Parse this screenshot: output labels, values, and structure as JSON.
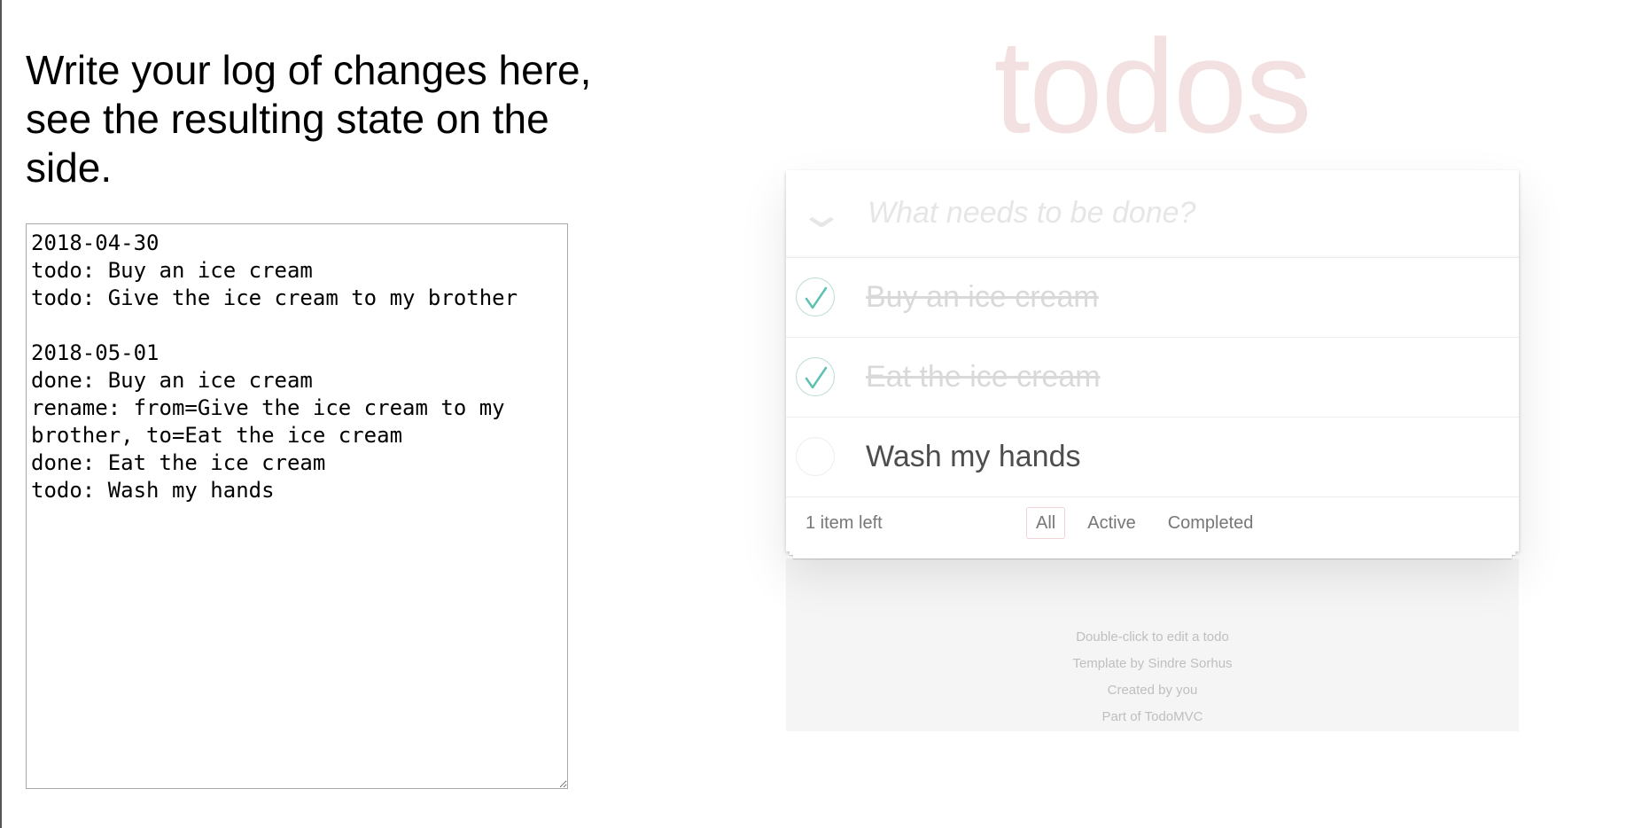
{
  "intro": {
    "text": "Write your log of changes here, see the resulting state on the side."
  },
  "log": {
    "value": "2018-04-30\ntodo: Buy an ice cream\ntodo: Give the ice cream to my brother\n\n2018-05-01\ndone: Buy an ice cream\nrename: from=Give the ice cream to my brother, to=Eat the ice cream\ndone: Eat the ice cream\ntodo: Wash my hands"
  },
  "todoapp": {
    "title": "todos",
    "new_todo_placeholder": "What needs to be done?",
    "toggle_all_icon": "chevron-down-icon",
    "items": [
      {
        "label": "Buy an ice cream",
        "completed": true
      },
      {
        "label": "Eat the ice cream",
        "completed": true
      },
      {
        "label": "Wash my hands",
        "completed": false
      }
    ],
    "footer": {
      "count": "1 item left",
      "filters": [
        "All",
        "Active",
        "Completed"
      ],
      "selected_filter": "All"
    },
    "colors": {
      "check": "#5dc2af",
      "title": "#af2f2f"
    }
  },
  "info": {
    "line1": "Double-click to edit a todo",
    "line2": "Template by Sindre Sorhus",
    "line3": "Created by you",
    "line4": "Part of TodoMVC"
  }
}
